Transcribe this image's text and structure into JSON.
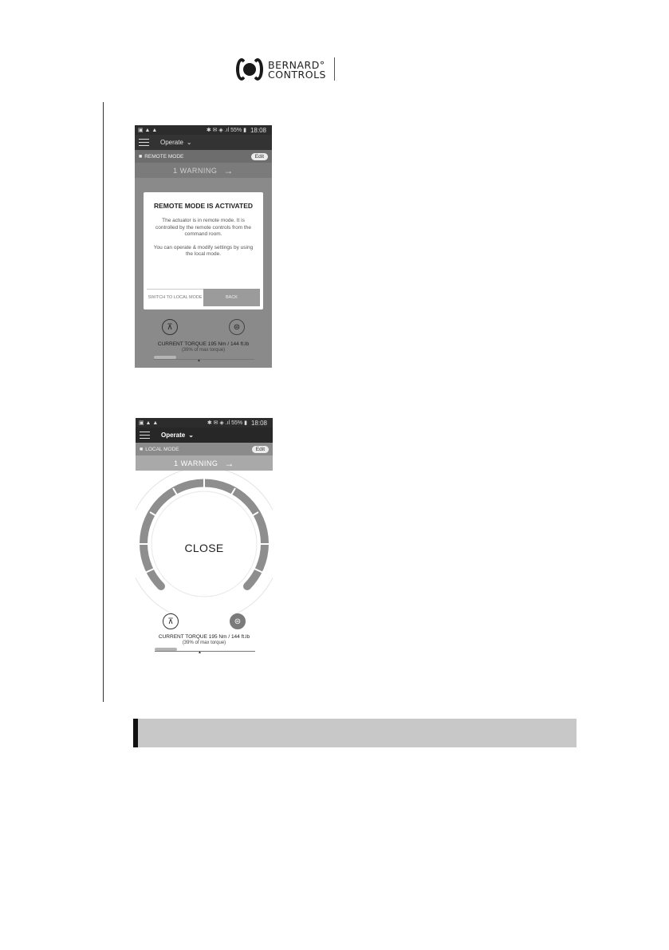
{
  "header": {
    "logo_line1": "BERNARD°",
    "logo_line2": "CONTROLS"
  },
  "colors": {
    "status_bar": "#2c2c2c",
    "app_bar": "#333333",
    "section_bar": "#c8c8c8"
  },
  "screen1": {
    "status": {
      "icons_left": "▣ ▲ ▲",
      "icons_right": "✱ ✉ ◈ .ıl 55% ▮",
      "time": "18:08"
    },
    "menu_label": "Operate",
    "mode_label": "REMOTE MODE",
    "edit_label": "Edit",
    "warning_label": "1 WARNING",
    "dialog": {
      "title": "REMOTE MODE IS ACTIVATED",
      "body1": "The actuator is in remote mode. It is controlled by the remote controls from the command room.",
      "body2": "You can operate & modify settings by using the local mode.",
      "switch_label": "SWITCH TO LOCAL MODE",
      "back_label": "BACK"
    },
    "torque_label": "CURRENT TORQUE 195 Nm / 144 ft.lb",
    "torque_sub": "(39% of max torque)",
    "torque_percent": 39
  },
  "screen2": {
    "status": {
      "icons_left": "▣ ▲ ▲",
      "icons_right": "✱ ✉ ◈ .ıl 55% ▮",
      "time": "18:08"
    },
    "menu_label": "Operate",
    "mode_label": "LOCAL MODE",
    "edit_label": "Edit",
    "warning_label": "1 WARNING",
    "dial_label": "CLOSE",
    "torque_label": "CURRENT TORQUE 195 Nm / 144 ft.lb",
    "torque_sub": "(39% of max torque)",
    "torque_percent": 39
  },
  "icons": {
    "open": "⊼",
    "stop": "⊜",
    "arrow": "→",
    "lock": "🔒",
    "chevron": "⌄"
  }
}
